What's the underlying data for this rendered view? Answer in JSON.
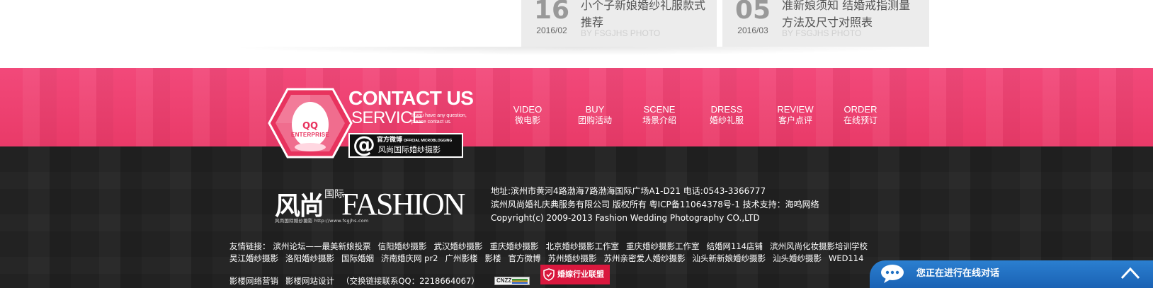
{
  "news": [
    {
      "day": "16",
      "ym": "2016/02",
      "title": "小个子新娘婚纱礼服款式推荐",
      "by": "BY FSGJHS PHOTO"
    },
    {
      "day": "05",
      "ym": "2016/03",
      "title": "准新娘须知 结婚戒指测量方法及尺寸对照表",
      "by": "BY FSGJHS PHOTO"
    }
  ],
  "contact": {
    "qq": "QQ",
    "enterprise": "ENTERPRISE",
    "title": "CONTACT US",
    "service": "SERVICE",
    "service_sub": "If you have any question, please contact us.",
    "weibo_cn": "官方微博",
    "weibo_en": "OFFICIAL MICROBLOGGING",
    "weibo_name": "风尚国际婚纱摄影"
  },
  "nav": [
    {
      "en": "VIDEO",
      "cn": "微电影"
    },
    {
      "en": "BUY",
      "cn": "团购活动"
    },
    {
      "en": "SCENE",
      "cn": "场景介绍"
    },
    {
      "en": "DRESS",
      "cn": "婚纱礼服"
    },
    {
      "en": "REVIEW",
      "cn": "客户点评"
    },
    {
      "en": "ORDER",
      "cn": "在线预订"
    }
  ],
  "logo": {
    "cn": "风尚",
    "cn_small": "国际",
    "en": "FASHION",
    "tagline": "风尚国际婚纱摄影 http://www.fsgjhs.com"
  },
  "footer": {
    "address": "地址:滨州市黄河4路渤海7路渤海国际广场A1-D21 电话:0543-3366777",
    "company": "滨州风尚婚礼庆典服务有限公司 版权所有 粤ICP备11064378号-1 技术支持：海鸣网络",
    "copyright": "Copyright(c) 2009-2013 Fashion Wedding Photography CO.,LTD"
  },
  "links": {
    "label": "友情链接：",
    "row1": [
      "滨州论坛——最美新娘投票",
      "信阳婚纱摄影",
      "武汉婚纱摄影",
      "重庆婚纱摄影",
      "北京婚纱摄影工作室",
      "重庆婚纱摄影工作室",
      "结婚网114店铺",
      "滨州风尚化妆摄影培训学校"
    ],
    "row2": [
      "吴江婚纱摄影",
      "洛阳婚纱摄影",
      "国际婚姻",
      "济南婚庆网 pr2",
      "广州影楼",
      "影楼",
      "官方微博",
      "苏州婚纱摄影",
      "苏州亲密爱人婚纱摄影",
      "汕头新新娘婚纱摄影",
      "汕头婚纱摄影",
      "WED114"
    ],
    "row3": [
      "影楼网络营销",
      "影楼网站设计"
    ],
    "exchange": "（交换链接联系QQ：2218664067）"
  },
  "cnzz": "CNZZ",
  "union": "婚嫁行业联盟",
  "chat": {
    "text": "您正在进行在线对话"
  },
  "colors": {
    "pink": "#ee3f6e",
    "dark": "#222222",
    "chat_blue": "#2272c4",
    "union_red": "#d9183e"
  }
}
